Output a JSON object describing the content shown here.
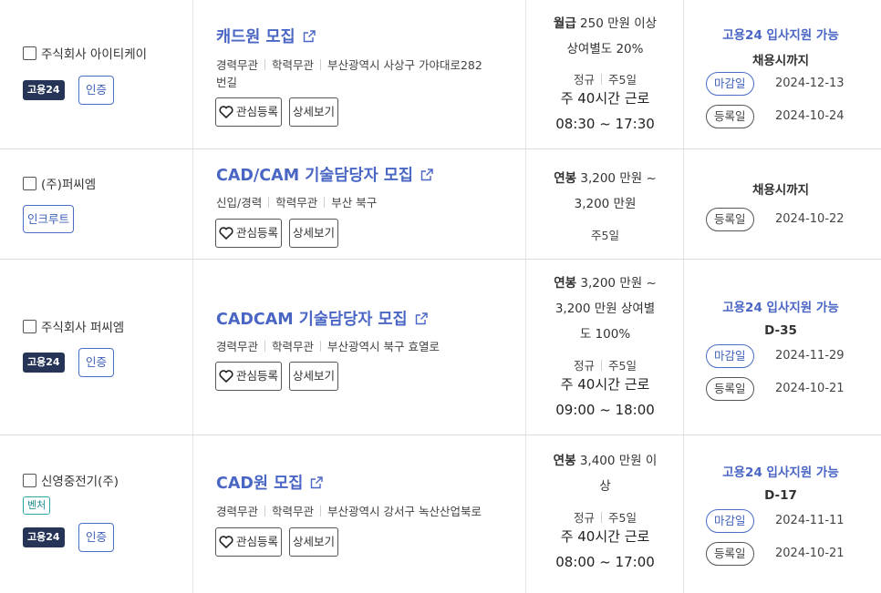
{
  "labels": {
    "gov_badge": "고용24",
    "certified": "인증",
    "incruit": "인크루트",
    "venture": "벤처",
    "favorite": "관심등록",
    "detail": "상세보기",
    "deadline_pill": "마감일",
    "registered_pill": "등록일"
  },
  "jobs": [
    {
      "company": "주식회사 아이티케이",
      "title": "캐드원 모집",
      "meta": [
        "경력무관",
        "학력무관",
        "부산광역시 사상구 가야대로282"
      ],
      "meta2": "번길",
      "salary_type": "월급",
      "salary_line1": "250 만원 이상",
      "salary_line2": "상여별도 20%",
      "emp_type": "정규",
      "days": "주5일",
      "hours": "주 40시간 근로",
      "time": "08:30 ~ 17:30",
      "support": "고용24 입사지원 가능",
      "deadline": "채용시까지",
      "deadline_date": "2024-12-13",
      "registered_date": "2024-10-24"
    },
    {
      "company": "(주)퍼씨엠",
      "title": "CAD/CAM 기술담당자 모집",
      "meta": [
        "신입/경력",
        "학력무관",
        "부산 북구"
      ],
      "salary_type": "연봉",
      "salary_line1": "3,200 만원 ~",
      "salary_line2": "3,200 만원",
      "days": "주5일",
      "deadline": "채용시까지",
      "registered_date": "2024-10-22"
    },
    {
      "company": "주식회사 퍼씨엠",
      "title": "CADCAM 기술담당자 모집",
      "meta": [
        "경력무관",
        "학력무관",
        "부산광역시 북구 효열로"
      ],
      "salary_type": "연봉",
      "salary_line1": "3,200 만원 ~",
      "salary_line2": "3,200 만원 상여별",
      "salary_line3": "도 100%",
      "emp_type": "정규",
      "days": "주5일",
      "hours": "주 40시간 근로",
      "time": "09:00 ~ 18:00",
      "support": "고용24 입사지원 가능",
      "deadline": "D-35",
      "deadline_date": "2024-11-29",
      "registered_date": "2024-10-21"
    },
    {
      "company": "신영중전기(주)",
      "title": "CAD원 모집",
      "meta": [
        "경력무관",
        "학력무관",
        "부산광역시 강서구 녹산산업북로"
      ],
      "salary_type": "연봉",
      "salary_line1": "3,400 만원 이",
      "salary_line2": "상",
      "emp_type": "정규",
      "days": "주5일",
      "hours": "주 40시간 근로",
      "time": "08:00 ~ 17:00",
      "support": "고용24 입사지원 가능",
      "deadline": "D-17",
      "deadline_date": "2024-11-11",
      "registered_date": "2024-10-21"
    }
  ]
}
